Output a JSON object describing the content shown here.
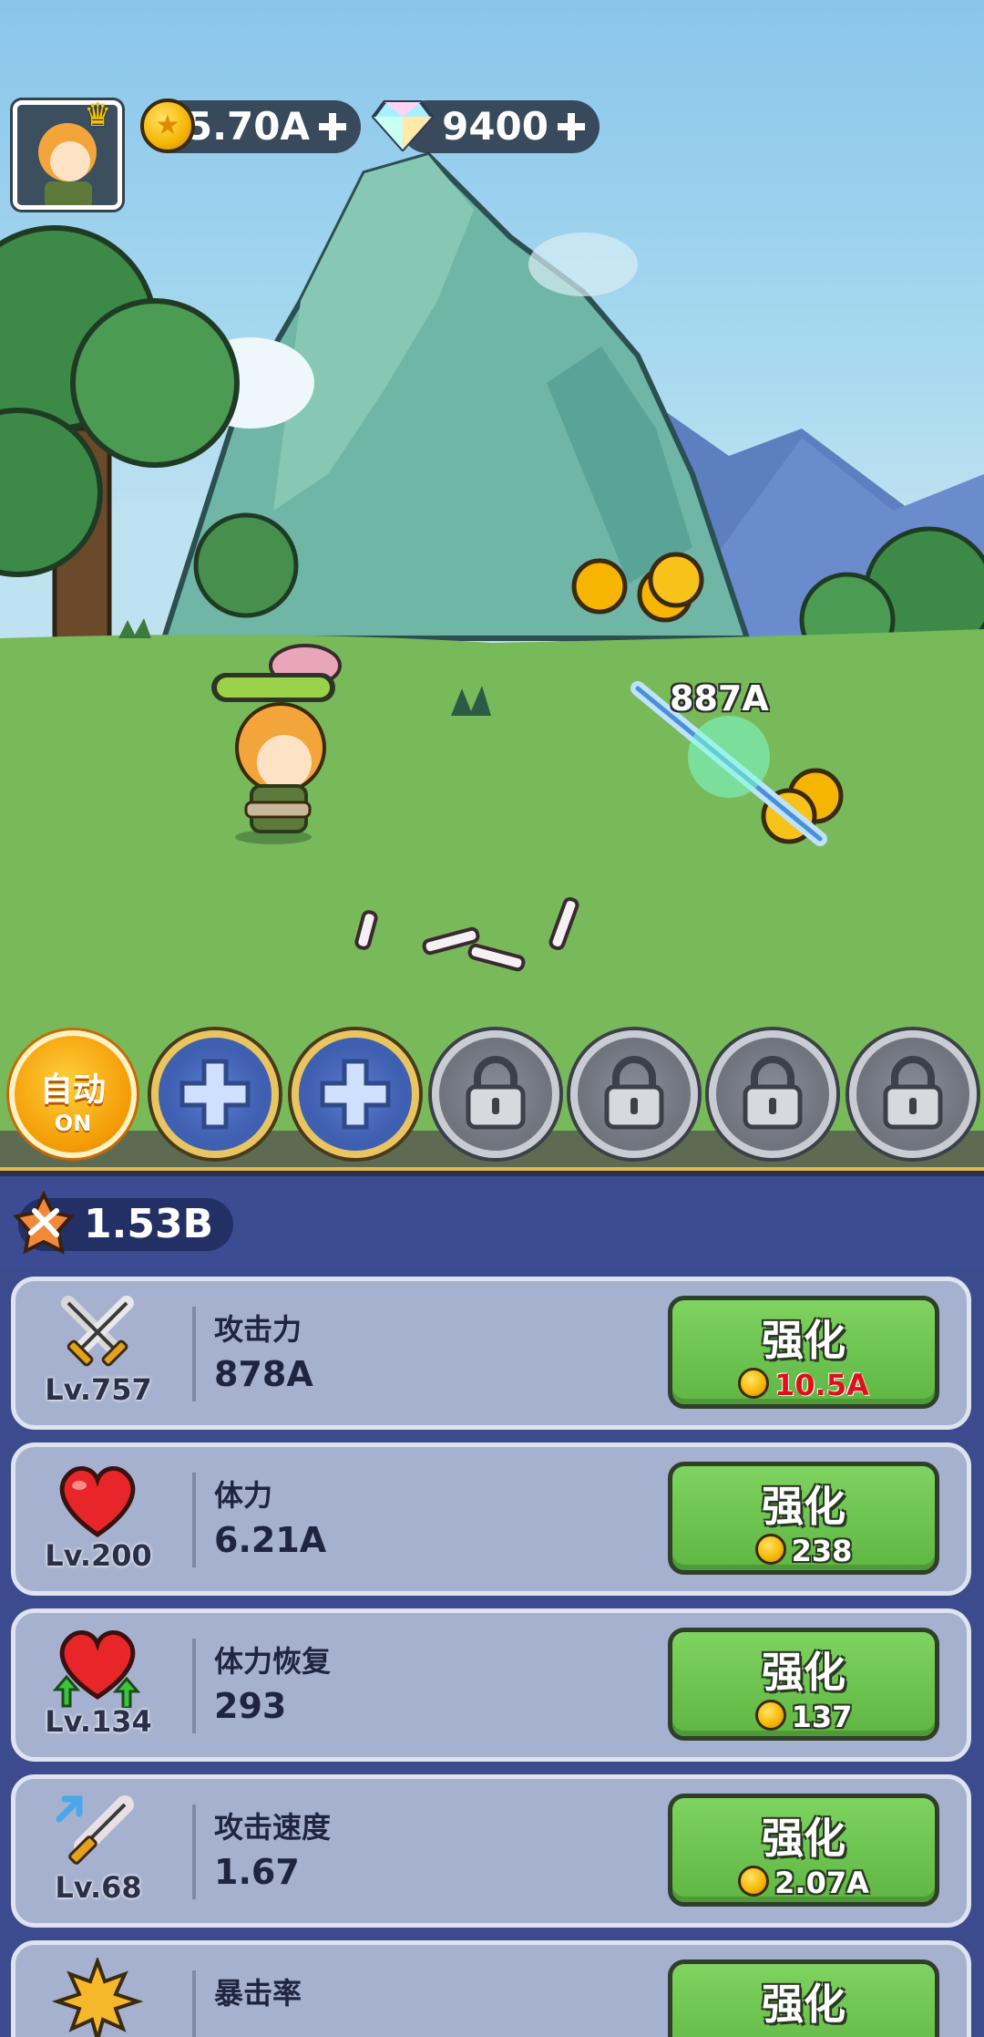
{
  "hud": {
    "gold": "5.70A",
    "gems": "9400"
  },
  "battle": {
    "damage_popup": "887A"
  },
  "skills": {
    "auto_label": "自动",
    "auto_state": "ON",
    "slots": [
      "add",
      "add",
      "locked",
      "locked",
      "locked",
      "locked"
    ]
  },
  "power": {
    "value": "1.53B"
  },
  "upgrades": [
    {
      "icon": "crossed-swords-icon",
      "level": "Lv.757",
      "name": "攻击力",
      "value": "878A",
      "button": "强化",
      "cost": "10.5A",
      "cost_color": "#e0101a"
    },
    {
      "icon": "heart-icon",
      "level": "Lv.200",
      "name": "体力",
      "value": "6.21A",
      "button": "强化",
      "cost": "238"
    },
    {
      "icon": "heart-regen-icon",
      "level": "Lv.134",
      "name": "体力恢复",
      "value": "293",
      "button": "强化",
      "cost": "137"
    },
    {
      "icon": "sword-speed-icon",
      "level": "Lv.68",
      "name": "攻击速度",
      "value": "1.67",
      "button": "强化",
      "cost": "2.07A"
    },
    {
      "icon": "critical-burst-icon",
      "level": "",
      "name": "暴击率",
      "value": "",
      "button": "强化",
      "cost": ""
    }
  ],
  "colors": {
    "panel": "#3c4b8e",
    "row": "#a5b1ce",
    "button": "#6cc24e",
    "gold": "#f5b500"
  }
}
